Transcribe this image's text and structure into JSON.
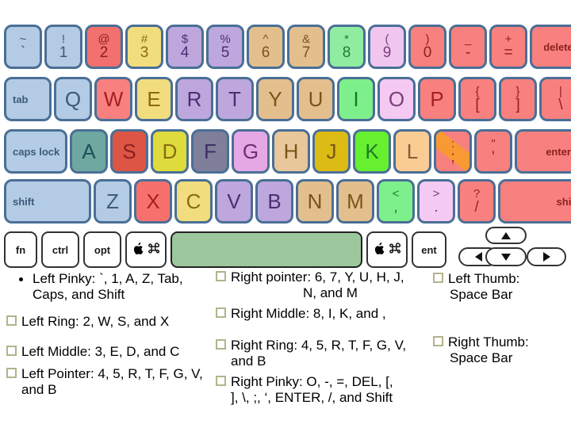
{
  "keyboard": {
    "rows": {
      "number_row": [
        {
          "name": "key-backtick",
          "top": "~",
          "bot": "`",
          "bg": "#b3cbe4",
          "fg": "#3c5a7a"
        },
        {
          "name": "key-1",
          "top": "!",
          "bot": "1",
          "bg": "#b3cbe4",
          "fg": "#3c5a7a"
        },
        {
          "name": "key-2",
          "top": "@",
          "bot": "2",
          "bg": "#f2706e",
          "fg": "#8c1f1f"
        },
        {
          "name": "key-3",
          "top": "#",
          "bot": "3",
          "bg": "#f2dd7e",
          "fg": "#8a6a10"
        },
        {
          "name": "key-4",
          "top": "$",
          "bot": "4",
          "bg": "#bda7dd",
          "fg": "#4b2f72"
        },
        {
          "name": "key-5",
          "top": "%",
          "bot": "5",
          "bg": "#bda7dd",
          "fg": "#4b2f72"
        },
        {
          "name": "key-6",
          "top": "^",
          "bot": "6",
          "bg": "#e3bf8e",
          "fg": "#7a5418"
        },
        {
          "name": "key-7",
          "top": "&",
          "bot": "7",
          "bg": "#e3bf8e",
          "fg": "#7a5418"
        },
        {
          "name": "key-8",
          "top": "*",
          "bot": "8",
          "bg": "#90eda0",
          "fg": "#1f7a33"
        },
        {
          "name": "key-9",
          "top": "(",
          "bot": "9",
          "bg": "#f0c6ef",
          "fg": "#7a3f7a"
        },
        {
          "name": "key-0",
          "top": ")",
          "bot": "0",
          "bg": "#f8807f",
          "fg": "#8c1f1f"
        },
        {
          "name": "key-minus",
          "top": "_",
          "bot": "-",
          "bg": "#f8807f",
          "fg": "#8c1f1f"
        },
        {
          "name": "key-equals",
          "top": "+",
          "bot": "=",
          "bg": "#f8807f",
          "fg": "#8c1f1f"
        },
        {
          "name": "key-delete",
          "word": "delete",
          "bg": "#f8807f",
          "fg": "#8c1f1f"
        }
      ],
      "qwerty_row": [
        {
          "name": "key-tab",
          "word": "tab",
          "bg": "#b3cbe4",
          "fg": "#3c5a7a"
        },
        {
          "name": "key-q",
          "single": "Q",
          "bg": "#b3cbe4",
          "fg": "#3c5a7a"
        },
        {
          "name": "key-w",
          "single": "W",
          "bg": "#f8807f",
          "fg": "#a61f1f"
        },
        {
          "name": "key-e",
          "single": "E",
          "bg": "#f2dd7e",
          "fg": "#8a6a10"
        },
        {
          "name": "key-r",
          "single": "R",
          "bg": "#bda7dd",
          "fg": "#4b2f72"
        },
        {
          "name": "key-t",
          "single": "T",
          "bg": "#bda7dd",
          "fg": "#4b2f72"
        },
        {
          "name": "key-y",
          "single": "Y",
          "bg": "#e3bf8e",
          "fg": "#7a5418"
        },
        {
          "name": "key-u",
          "single": "U",
          "bg": "#e3bf8e",
          "fg": "#7a5418"
        },
        {
          "name": "key-i",
          "single": "I",
          "bg": "#7ef08b",
          "fg": "#0f7a24"
        },
        {
          "name": "key-o",
          "single": "O",
          "bg": "#f4c9f2",
          "fg": "#7a3f7a"
        },
        {
          "name": "key-p",
          "single": "P",
          "bg": "#f8807f",
          "fg": "#a61f1f"
        },
        {
          "name": "key-bracket-left",
          "top": "{",
          "bot": "[",
          "bg": "#f8807f",
          "fg": "#8c1f1f"
        },
        {
          "name": "key-bracket-right",
          "top": "}",
          "bot": "]",
          "bg": "#f8807f",
          "fg": "#8c1f1f"
        },
        {
          "name": "key-backslash",
          "top": "|",
          "bot": "\\",
          "bg": "#f8807f",
          "fg": "#8c1f1f"
        }
      ],
      "home_row": [
        {
          "name": "key-caps-lock",
          "word": "caps lock",
          "bg": "#b3cbe4",
          "fg": "#3c5a7a"
        },
        {
          "name": "key-a",
          "single": "A",
          "bg": "#6fa8a0",
          "fg": "#1f4f58"
        },
        {
          "name": "key-s",
          "single": "S",
          "bg": "#dd5544",
          "fg": "#8c1f1f"
        },
        {
          "name": "key-d",
          "single": "D",
          "bg": "#dedb3c",
          "fg": "#8a6a10"
        },
        {
          "name": "key-f",
          "single": "F",
          "bg": "#7f7f99",
          "fg": "#3a2f66"
        },
        {
          "name": "key-g",
          "single": "G",
          "bg": "#e5a8e5",
          "fg": "#6a2f72"
        },
        {
          "name": "key-h",
          "single": "H",
          "bg": "#e8c79a",
          "fg": "#7a5418"
        },
        {
          "name": "key-j",
          "single": "J",
          "bg": "#dcbb14",
          "fg": "#7a5418"
        },
        {
          "name": "key-k",
          "single": "K",
          "bg": "#66f030",
          "fg": "#1f7a24"
        },
        {
          "name": "key-l",
          "single": "L",
          "bg": "#f8cc93",
          "fg": "#8a5a3a"
        },
        {
          "name": "key-semicolon",
          "top": ":",
          "bot": ";",
          "bg": "#f8807f",
          "fg": "#a61f1f",
          "stripe": "#f89a33"
        },
        {
          "name": "key-quote",
          "top": "\"",
          "bot": "'",
          "bg": "#f8807f",
          "fg": "#a61f1f"
        },
        {
          "name": "key-enter",
          "word": "enter",
          "bg": "#f8807f",
          "fg": "#8c1f1f"
        }
      ],
      "shift_row": [
        {
          "name": "key-shift-left",
          "word": "shift",
          "bg": "#b3cbe4",
          "fg": "#3c5a7a"
        },
        {
          "name": "key-z",
          "single": "Z",
          "bg": "#b3cbe4",
          "fg": "#3c5a7a"
        },
        {
          "name": "key-x",
          "single": "X",
          "bg": "#f8706e",
          "fg": "#a61f1f"
        },
        {
          "name": "key-c",
          "single": "C",
          "bg": "#f2dd7e",
          "fg": "#8a6a10"
        },
        {
          "name": "key-v",
          "single": "V",
          "bg": "#bda7dd",
          "fg": "#4b2f72"
        },
        {
          "name": "key-b",
          "single": "B",
          "bg": "#bda7dd",
          "fg": "#4b2f72"
        },
        {
          "name": "key-n",
          "single": "N",
          "bg": "#e3bf8e",
          "fg": "#7a5418"
        },
        {
          "name": "key-m",
          "single": "M",
          "bg": "#e3bf8e",
          "fg": "#7a5418"
        },
        {
          "name": "key-comma",
          "top": "<",
          "bot": ",",
          "bg": "#7ef08b",
          "fg": "#1f7a33"
        },
        {
          "name": "key-period",
          "top": ">",
          "bot": ".",
          "bg": "#f4c9f2",
          "fg": "#7a3f7a"
        },
        {
          "name": "key-slash",
          "top": "?",
          "bot": "/",
          "bg": "#f8807f",
          "fg": "#a61f1f"
        },
        {
          "name": "key-shift-right",
          "word": "shift",
          "bg": "#f8807f",
          "fg": "#8c1f1f"
        }
      ],
      "bottom_row": [
        {
          "name": "key-fn",
          "word": "fn"
        },
        {
          "name": "key-ctrl",
          "word": "ctrl"
        },
        {
          "name": "key-opt",
          "word": "opt"
        },
        {
          "name": "key-command-left",
          "icons": [
            "apple-logo-icon",
            "command-icon"
          ]
        },
        {
          "name": "key-space",
          "word": ""
        },
        {
          "name": "key-command-right",
          "icons": [
            "apple-logo-icon",
            "command-icon"
          ]
        },
        {
          "name": "key-ent",
          "word": "ent"
        }
      ],
      "arrow_keys": [
        {
          "name": "key-arrow-up",
          "dir": "up"
        },
        {
          "name": "key-arrow-left",
          "dir": "left"
        },
        {
          "name": "key-arrow-down",
          "dir": "down"
        },
        {
          "name": "key-arrow-right",
          "dir": "right"
        }
      ]
    }
  },
  "notes": {
    "left_column": [
      {
        "marker": "dot",
        "lines": [
          "Left Pinky: `, 1, A, Z, Tab,",
          "Caps, and Shift"
        ]
      },
      {
        "marker": "square",
        "lines": [
          "Left Ring: 2, W, S, and X"
        ]
      },
      {
        "marker": "square",
        "lines": [
          "Left Middle: 3, E, D, and C"
        ]
      },
      {
        "marker": "square",
        "lines": [
          "Left Pointer: 4, 5, R, T, F, G, V,",
          "and B"
        ]
      }
    ],
    "middle_column": [
      {
        "marker": "square",
        "lines": [
          "Right pointer: 6, 7, Y, U, H, J,",
          "N, and M"
        ],
        "center_second": true
      },
      {
        "marker": "square",
        "lines": [
          "Right Middle: 8, I, K, and ,"
        ]
      },
      {
        "marker": "square",
        "lines": [
          "Right  Ring: 4, 5, R, T, F, G, V,",
          "and B"
        ]
      },
      {
        "marker": "square",
        "lines": [
          "Right Pinky: O, -, =, DEL, [,",
          "], \\, ;, ‘, ENTER, /, and Shift"
        ]
      }
    ],
    "right_column": [
      {
        "marker": "square",
        "lines": [
          "Left Thumb:",
          "Space Bar"
        ]
      },
      {
        "marker": "square",
        "lines": [
          "Right Thumb:",
          "Space Bar"
        ]
      }
    ]
  },
  "theme": {
    "key_border": "#4a6f96",
    "marker_color": "#b3b38a",
    "space_fill": "#9cc79c"
  }
}
